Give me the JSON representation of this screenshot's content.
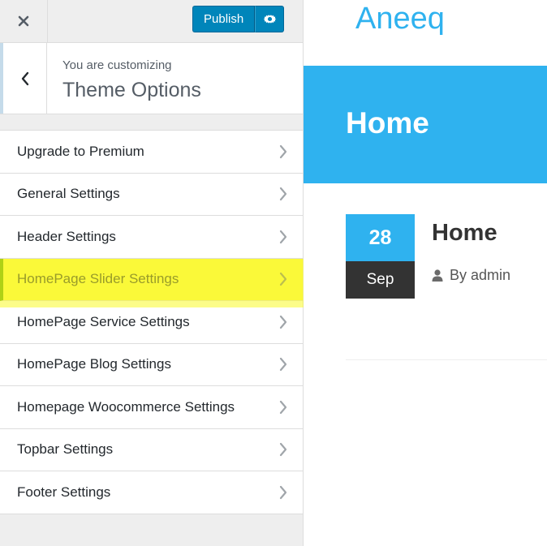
{
  "colors": {
    "accent": "#2fb2ef",
    "publish_blue": "#0085ba",
    "highlight_yellow": "#fbf94f",
    "sidebar_bg": "#eeeeee",
    "text_dark": "#23282d"
  },
  "topbar": {
    "close_icon": "close-icon",
    "publish_label": "Publish",
    "settings_icon": "gear-icon"
  },
  "section": {
    "back_icon": "chevron-left-icon",
    "customizing_label": "You are customizing",
    "title": "Theme Options"
  },
  "menu": {
    "items": [
      {
        "label": "Upgrade to Premium"
      },
      {
        "label": "General Settings"
      },
      {
        "label": "Header Settings"
      },
      {
        "label": "HomePage Slider Settings",
        "highlighted": true
      },
      {
        "label": "HomePage Service Settings"
      },
      {
        "label": "HomePage Blog Settings"
      },
      {
        "label": "Homepage Woocommerce Settings"
      },
      {
        "label": "Topbar Settings"
      },
      {
        "label": "Footer Settings"
      }
    ]
  },
  "preview": {
    "site_title": "Aneeq",
    "hero_title": "Home",
    "post": {
      "day": "28",
      "month": "Sep",
      "title": "Home",
      "author_prefix": "By admin",
      "author_icon": "user-icon"
    }
  }
}
